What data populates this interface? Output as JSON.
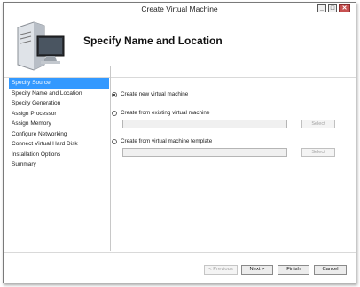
{
  "window": {
    "title": "Create Virtual Machine",
    "controls": [
      "_",
      "□",
      "✕"
    ]
  },
  "header": {
    "title": "Specify Name and Location"
  },
  "sidebar": {
    "items": [
      {
        "label": "Specify Source",
        "active": true
      },
      {
        "label": "Specify Name and Location",
        "active": false
      },
      {
        "label": "Specify Generation",
        "active": false
      },
      {
        "label": "Assign Processor",
        "active": false
      },
      {
        "label": "Assign Memory",
        "active": false
      },
      {
        "label": "Configure Networking",
        "active": false
      },
      {
        "label": "Connect Virtual Hard Disk",
        "active": false
      },
      {
        "label": "Installation Options",
        "active": false
      },
      {
        "label": "Summary",
        "active": false
      }
    ]
  },
  "options": {
    "new_vm": {
      "label": "Create new virtual machine",
      "checked": true
    },
    "existing_vm": {
      "label": "Create from existing virtual machine",
      "checked": false,
      "path_value": "",
      "select_label": "Select"
    },
    "template_vm": {
      "label": "Create from virtual machine template",
      "checked": false,
      "path_value": "",
      "select_label": "Select"
    }
  },
  "footer": {
    "previous": "< Previous",
    "next": "Next >",
    "finish": "Finish",
    "cancel": "Cancel"
  }
}
